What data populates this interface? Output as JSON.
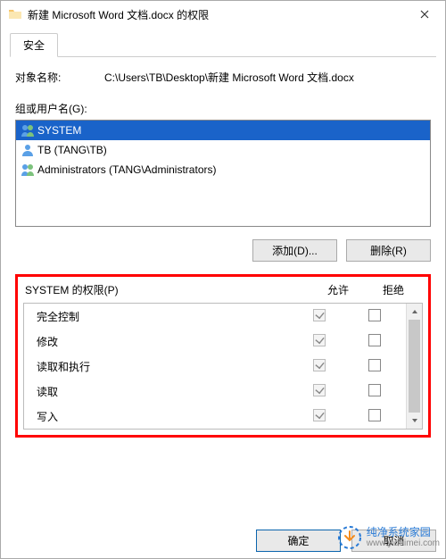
{
  "window": {
    "title": "新建 Microsoft Word 文档.docx 的权限",
    "icon_name": "folder-icon"
  },
  "tab": {
    "security_label": "安全"
  },
  "object": {
    "label": "对象名称:",
    "path": "C:\\Users\\TB\\Desktop\\新建 Microsoft Word 文档.docx"
  },
  "groups": {
    "label": "组或用户名(G):",
    "items": [
      {
        "name": "SYSTEM",
        "selected": true,
        "icon": "group-icon"
      },
      {
        "name": "TB (TANG\\TB)",
        "selected": false,
        "icon": "user-icon"
      },
      {
        "name": "Administrators (TANG\\Administrators)",
        "selected": false,
        "icon": "group-icon"
      }
    ],
    "add_label": "添加(D)...",
    "remove_label": "删除(R)"
  },
  "permissions": {
    "header_title": "SYSTEM 的权限(P)",
    "col_allow": "允许",
    "col_deny": "拒绝",
    "rows": [
      {
        "label": "完全控制",
        "allow": true,
        "deny": false
      },
      {
        "label": "修改",
        "allow": true,
        "deny": false
      },
      {
        "label": "读取和执行",
        "allow": true,
        "deny": false
      },
      {
        "label": "读取",
        "allow": true,
        "deny": false
      },
      {
        "label": "写入",
        "allow": true,
        "deny": false
      }
    ]
  },
  "dialog": {
    "ok": "确定",
    "cancel": "取消"
  },
  "watermark": {
    "text": "纯净系统家园",
    "url": "www.yidaimei.com"
  }
}
